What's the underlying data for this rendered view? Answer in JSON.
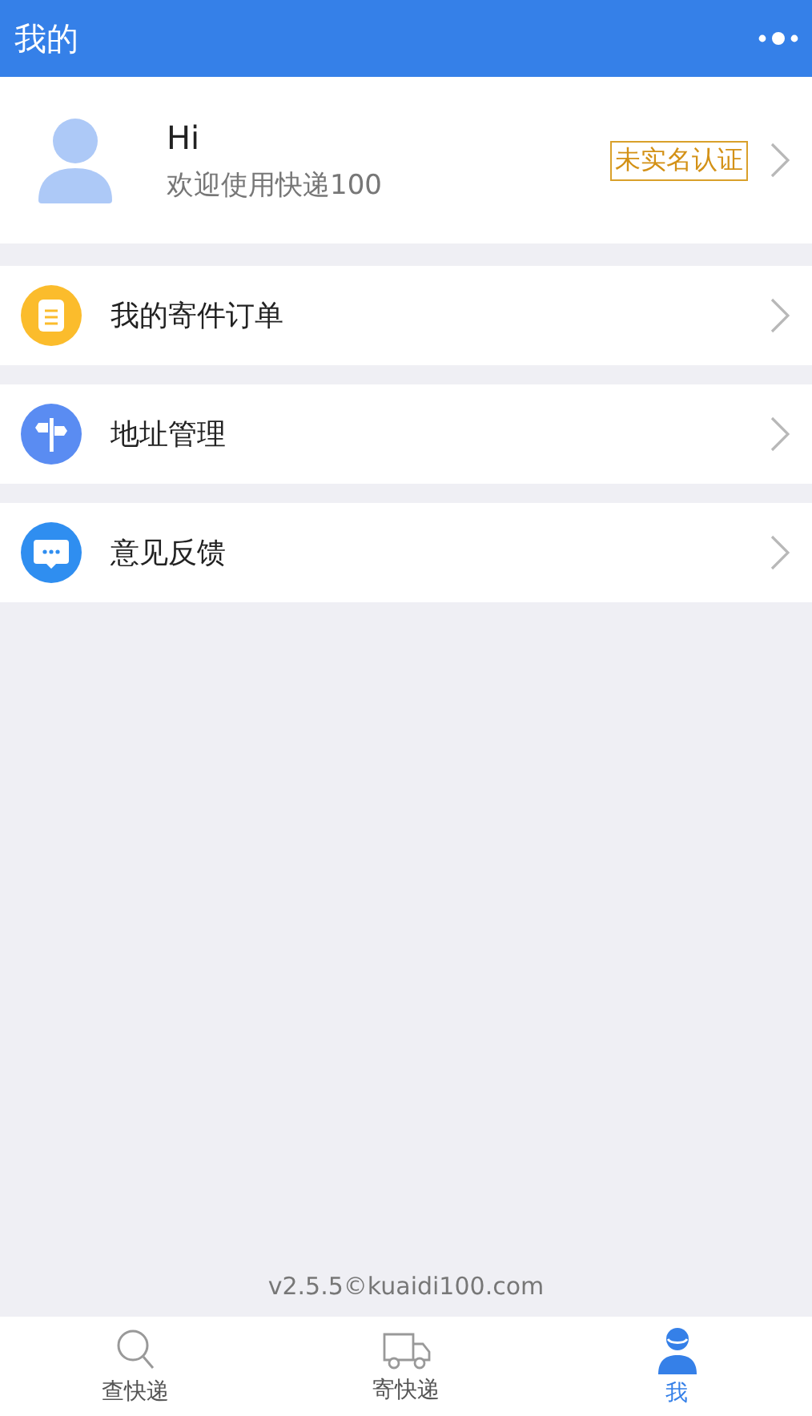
{
  "header": {
    "title": "我的"
  },
  "profile": {
    "greeting": "Hi",
    "subtitle": "欢迎使用快递100",
    "badge": "未实名认证"
  },
  "menu": [
    {
      "label": "我的寄件订单",
      "kind": "order",
      "color": "#fbbc2c"
    },
    {
      "label": "地址管理",
      "kind": "address",
      "color": "#5a8cf2"
    },
    {
      "label": "意见反馈",
      "kind": "feedback",
      "color": "#2f8ef0"
    }
  ],
  "footer": "v2.5.5©kuaidi100.com",
  "tabs": [
    {
      "label": "查快递",
      "kind": "search",
      "selected": false
    },
    {
      "label": "寄快递",
      "kind": "truck",
      "selected": false
    },
    {
      "label": "我",
      "kind": "person",
      "selected": true
    }
  ]
}
